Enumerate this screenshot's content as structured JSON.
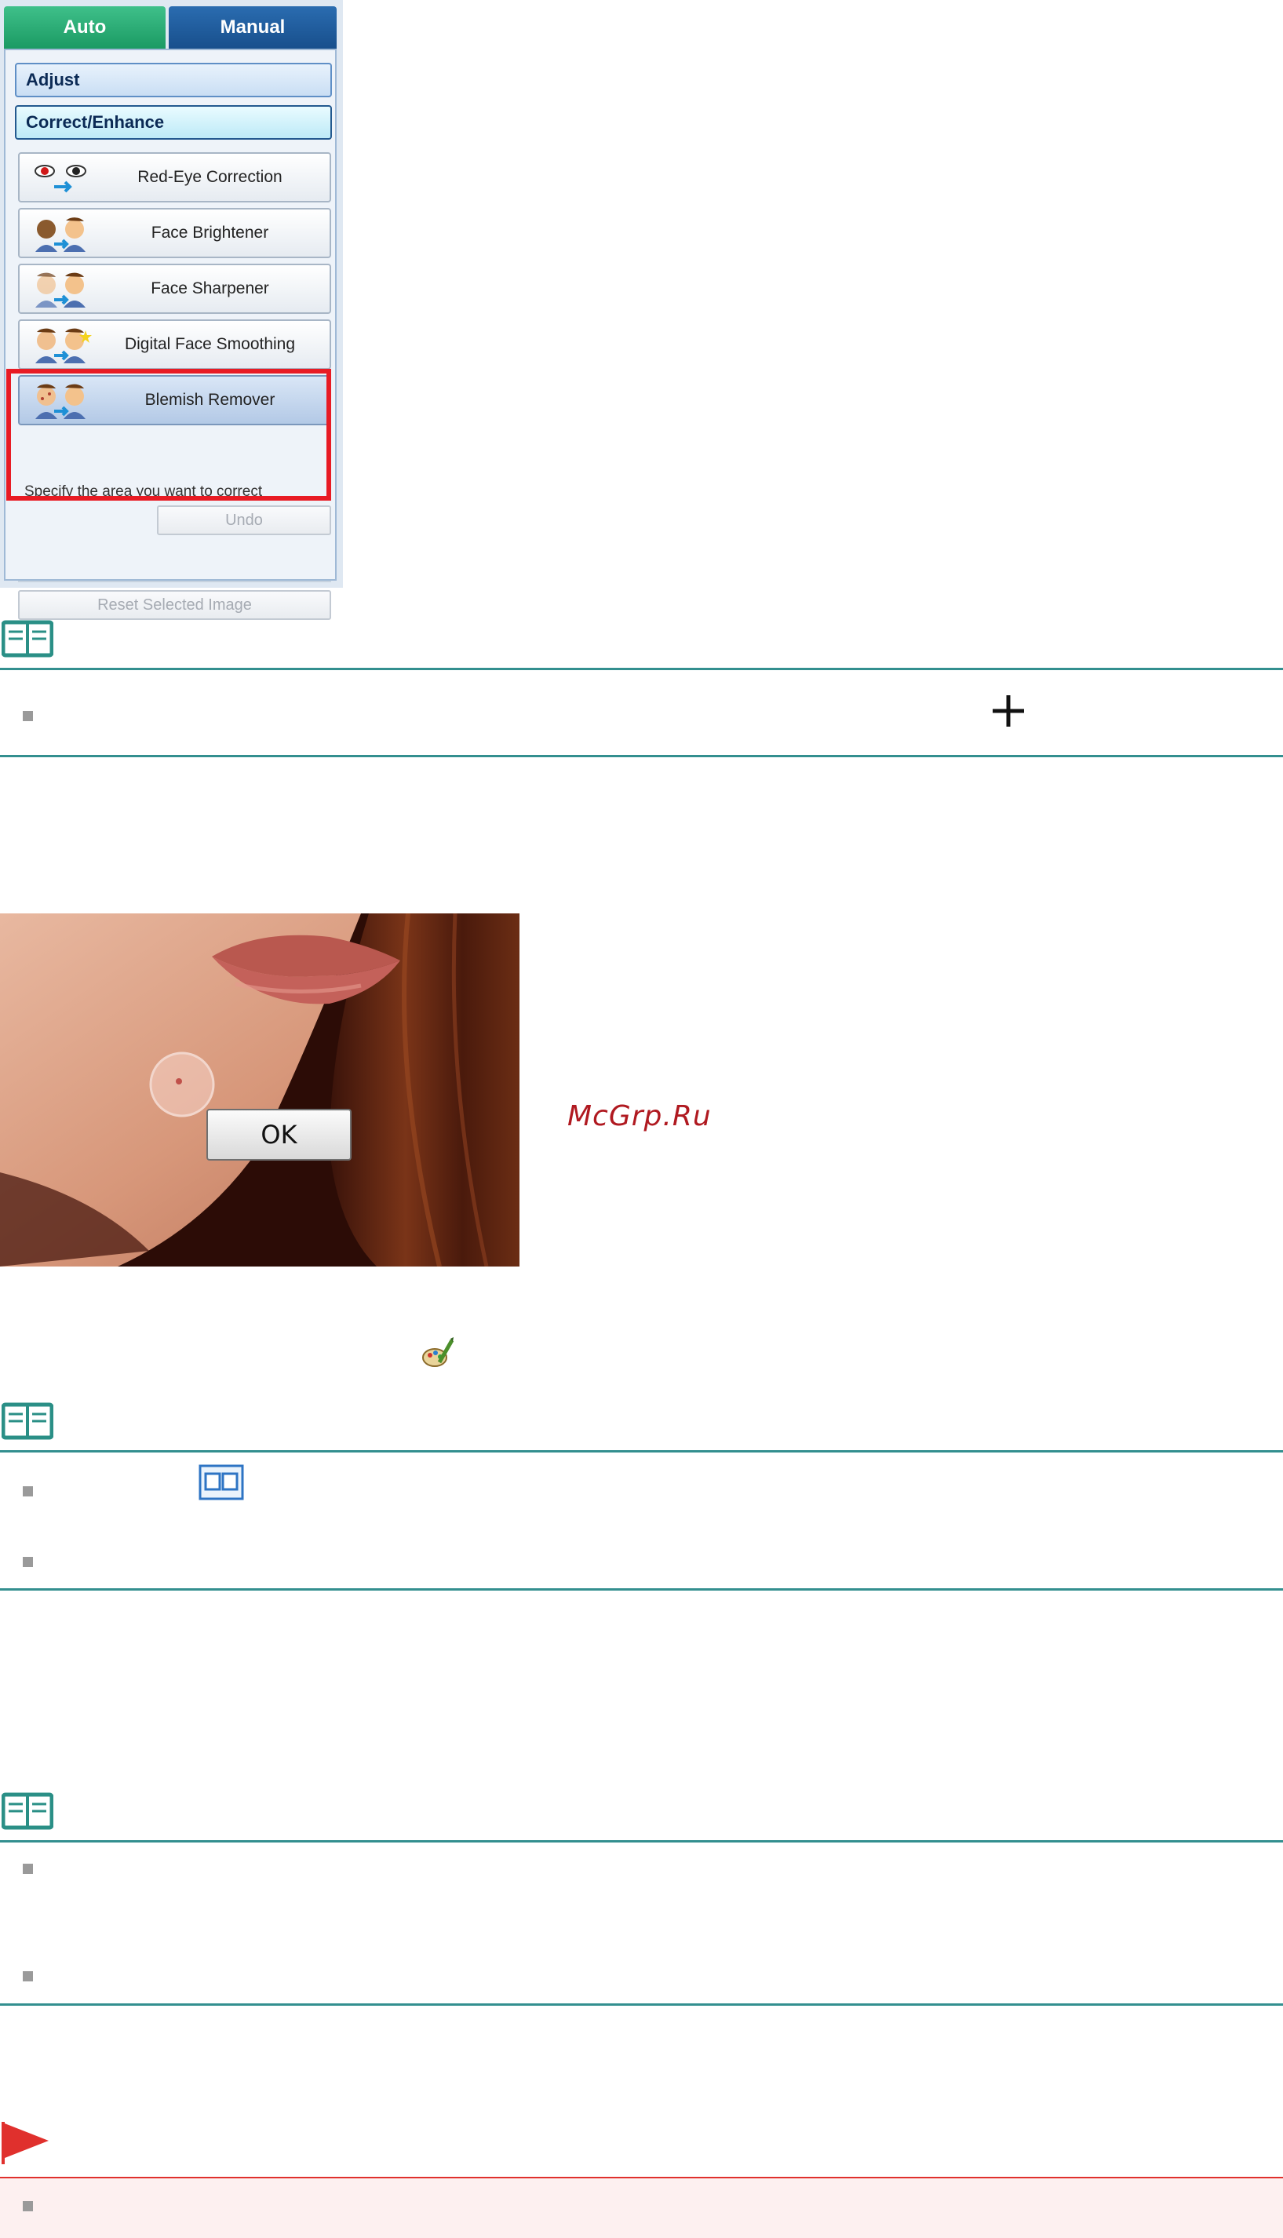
{
  "panel": {
    "tabs": {
      "auto": "Auto",
      "manual": "Manual"
    },
    "sections": {
      "adjust": "Adjust",
      "correct_enhance": "Correct/Enhance"
    },
    "tools": [
      {
        "label": "Red-Eye Correction",
        "icon": "red-eye-icon"
      },
      {
        "label": "Face Brightener",
        "icon": "face-brightener-icon"
      },
      {
        "label": "Face Sharpener",
        "icon": "face-sharpener-icon"
      },
      {
        "label": "Digital Face Smoothing",
        "icon": "face-smoothing-icon"
      },
      {
        "label": "Blemish Remover",
        "icon": "blemish-remover-icon"
      }
    ],
    "hint": "Specify the area you want to correct",
    "undo": "Undo",
    "reset": "Reset Selected Image"
  },
  "photo": {
    "ok_label": "OK"
  },
  "watermark": "McGrp.Ru",
  "colors": {
    "accent_teal": "#338f8f",
    "highlight_red": "#e81b24",
    "warning_bg": "#fdf0f0"
  }
}
